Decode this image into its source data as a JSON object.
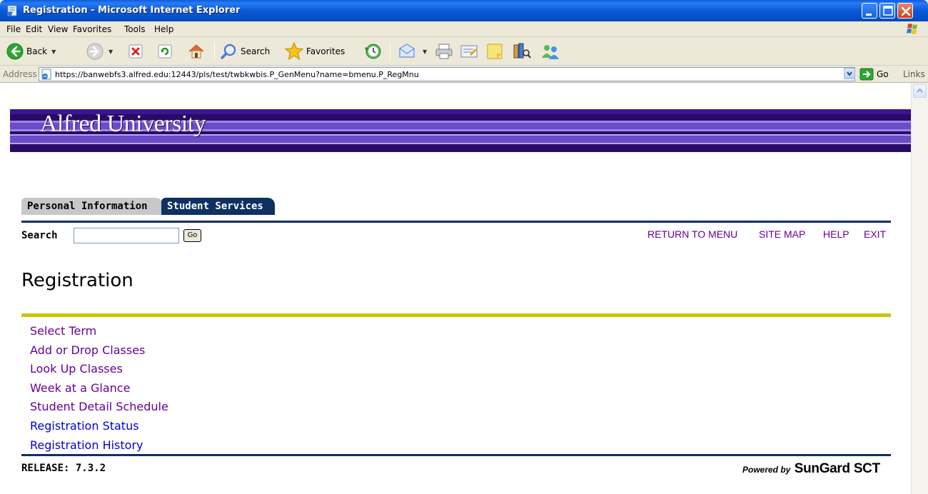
{
  "window": {
    "title": "Registration - Microsoft Internet Explorer"
  },
  "menubar": [
    "File",
    "Edit",
    "View",
    "Favorites",
    "Tools",
    "Help"
  ],
  "toolbar": {
    "back": "Back",
    "search": "Search",
    "favorites": "Favorites"
  },
  "address": {
    "label": "Address",
    "url": "https://banwebfs3.alfred.edu:12443/pls/test/twbkwbis.P_GenMenu?name=bmenu.P_RegMnu",
    "go": "Go",
    "links": "Links"
  },
  "banner": {
    "brand": "Alfred University"
  },
  "tabs": [
    {
      "label": "Personal Information",
      "active": false
    },
    {
      "label": "Student Services",
      "active": true
    }
  ],
  "search": {
    "label": "Search",
    "value": "",
    "go": "Go"
  },
  "toplinks": [
    "RETURN TO MENU",
    "SITE MAP",
    "HELP",
    "EXIT"
  ],
  "page": {
    "title": "Registration"
  },
  "menu_links": [
    {
      "label": "Select Term"
    },
    {
      "label": "Add or Drop Classes"
    },
    {
      "label": "Look Up Classes"
    },
    {
      "label": "Week at a Glance"
    },
    {
      "label": "Student Detail Schedule"
    },
    {
      "label": "Registration Status"
    },
    {
      "label": "Registration History"
    }
  ],
  "footer": {
    "release": "RELEASE: 7.3.2",
    "powered_by": "Powered by",
    "vendor": "SunGard SCT"
  },
  "colors": {
    "banner": "#2a0a66",
    "tab_active": "#0e3063",
    "divider_yellow": "#c8c800",
    "link_visited": "#660099",
    "link_unvisited": "#0000cc"
  }
}
